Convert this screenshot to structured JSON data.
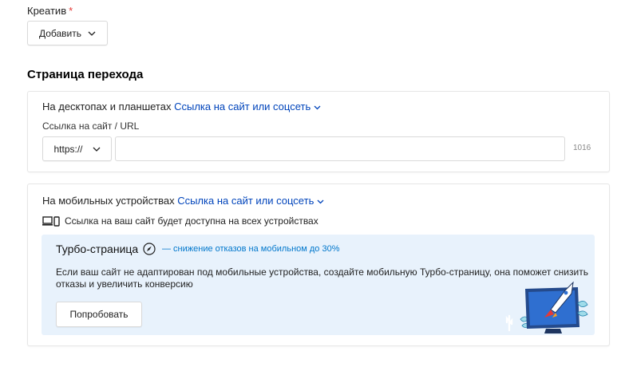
{
  "creative": {
    "label": "Креатив",
    "required_mark": "*",
    "add_button": "Добавить"
  },
  "landing": {
    "section_title": "Страница перехода",
    "desktop": {
      "prefix": "На десктопах и планшетах",
      "link": "Ссылка на сайт или соцсеть",
      "url_label": "Ссылка на сайт / URL",
      "protocol": "https://",
      "url_value": "",
      "char_counter": "1016"
    },
    "mobile": {
      "prefix": "На мобильных устройствах",
      "link": "Ссылка на сайт или соцсеть",
      "note": "Ссылка на ваш сайт будет доступна на всех устройствах",
      "turbo": {
        "title": "Турбо-страница",
        "tag": "— снижение отказов на мобильном до 30%",
        "text": "Если ваш сайт не адаптирован под мобильные устройства, создайте мобильную Турбо-страницу, она поможет снизить отказы и увеличить конверсию",
        "try_button": "Попробовать"
      }
    }
  },
  "colors": {
    "link": "#0044bb",
    "turbo_bg": "#e8f2fc",
    "required": "#e53935",
    "turbo_tag": "#0077cc"
  }
}
